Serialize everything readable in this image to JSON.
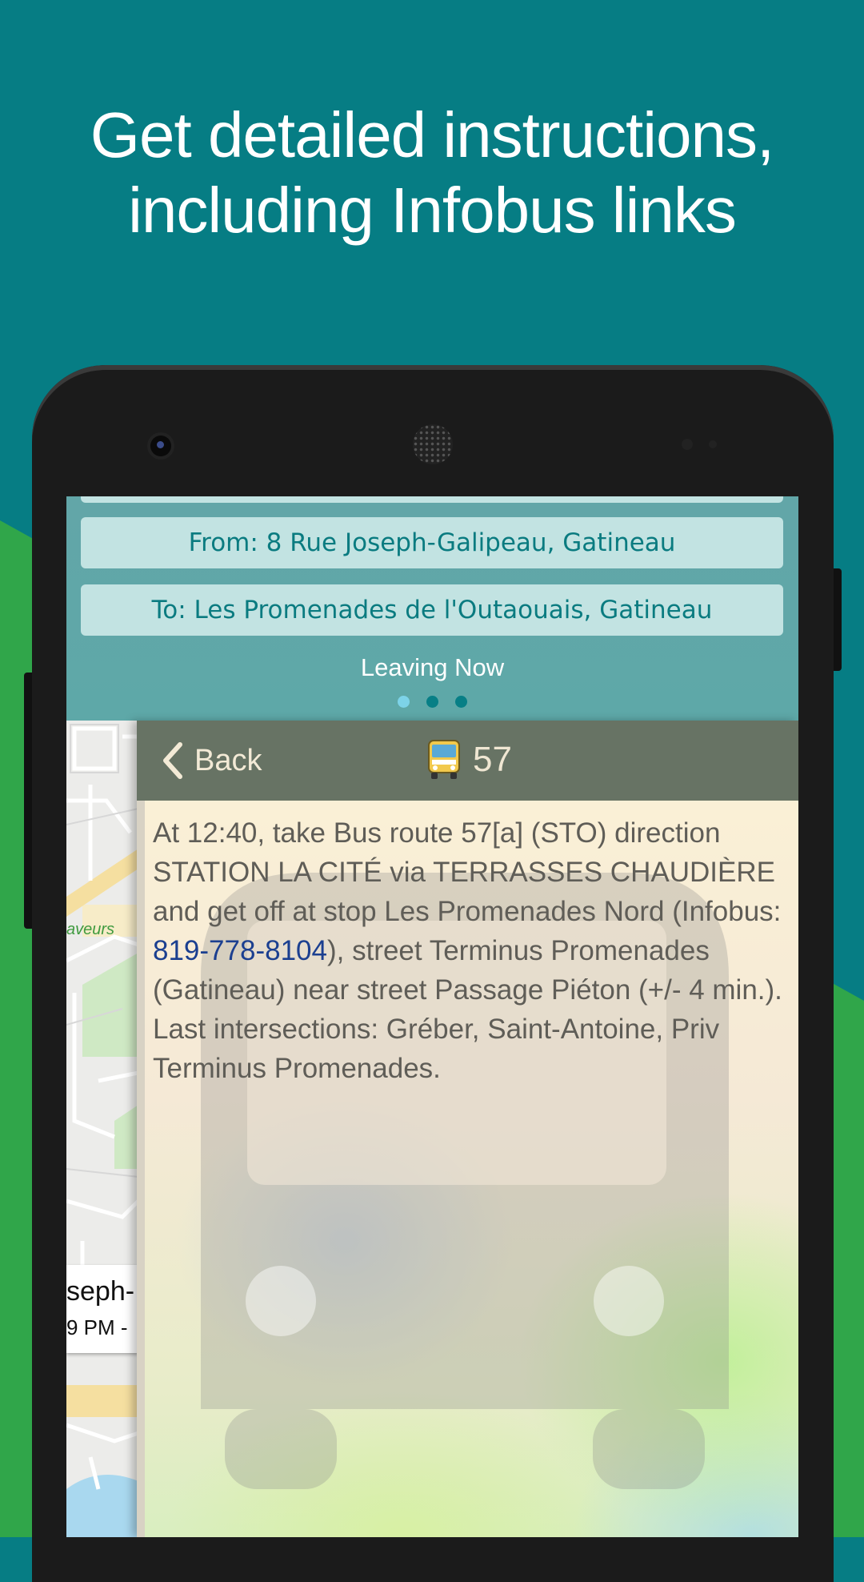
{
  "headline": {
    "line1": "Get detailed instructions,",
    "line2": "including Infobus links"
  },
  "colors": {
    "background_teal": "#067d84",
    "background_green": "#30a64a",
    "panel": "#5fa7a8",
    "pill": "#c2e3e2",
    "nav_bar": "#677364",
    "link": "#1b3f90"
  },
  "trip_panel": {
    "from": "From: 8 Rue Joseph-Galipeau, Gatineau",
    "to": "To: Les Promenades de l'Outaouais, Gatineau",
    "time_mode": "Leaving Now",
    "page_indicator": {
      "pages": 3,
      "active": 1
    }
  },
  "map": {
    "label": "aveurs",
    "popup_title": "seph-",
    "popup_time": "9 PM -"
  },
  "detail": {
    "back_label": "Back",
    "back_icon": "chevron-left-icon",
    "route_icon": "bus-icon",
    "route_number": "57",
    "instruction_part1": "At 12:40, take Bus route 57[a] (STO) direction STATION LA CITÉ via TERRASSES CHAUDIÈRE and get off at stop Les Promenades Nord (Infobus: ",
    "infobus_phone": "819-778-8104",
    "instruction_part2": "), street Terminus Promenades (Gatineau) near street Passage Piéton (+/- 4 min.).",
    "last_intersections": "Last intersections: Gréber, Saint-Antoine, Priv Terminus Promenades."
  }
}
